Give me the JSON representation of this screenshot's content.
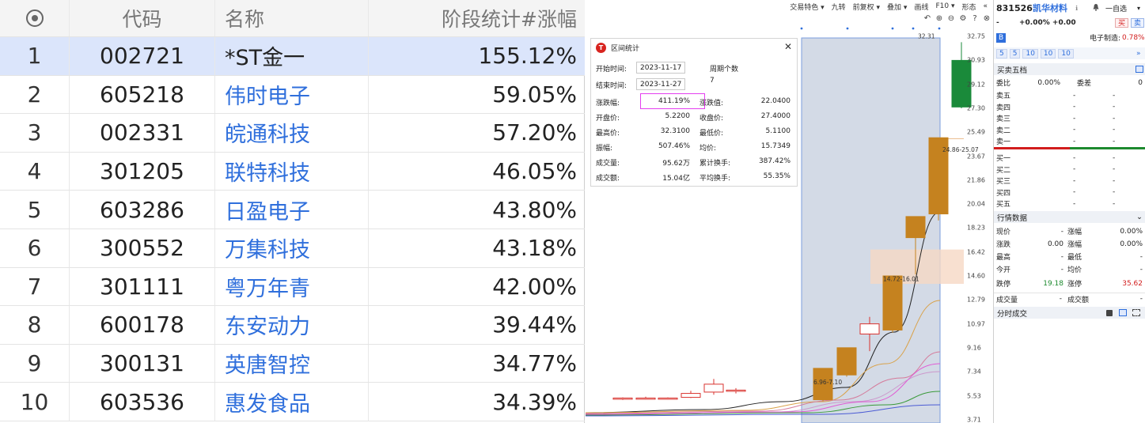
{
  "table": {
    "headers": {
      "code": "代码",
      "name": "名称",
      "pct": "阶段统计#涨幅"
    },
    "rows": [
      {
        "idx": "1",
        "code": "002721",
        "name": "*ST金一",
        "pct": "155.12%"
      },
      {
        "idx": "2",
        "code": "605218",
        "name": "伟时电子",
        "pct": "59.05%"
      },
      {
        "idx": "3",
        "code": "002331",
        "name": "皖通科技",
        "pct": "57.20%"
      },
      {
        "idx": "4",
        "code": "301205",
        "name": "联特科技",
        "pct": "46.05%"
      },
      {
        "idx": "5",
        "code": "603286",
        "name": "日盈电子",
        "pct": "43.80%"
      },
      {
        "idx": "6",
        "code": "300552",
        "name": "万集科技",
        "pct": "43.18%"
      },
      {
        "idx": "7",
        "code": "301111",
        "name": "粤万年青",
        "pct": "42.00%"
      },
      {
        "idx": "8",
        "code": "600178",
        "name": "东安动力",
        "pct": "39.44%"
      },
      {
        "idx": "9",
        "code": "300131",
        "name": "英唐智控",
        "pct": "34.77%"
      },
      {
        "idx": "10",
        "code": "603536",
        "name": "惠发食品",
        "pct": "34.39%"
      }
    ]
  },
  "chart_toolbar": [
    "交易特色 ▾",
    "九转",
    "前复权 ▾",
    "叠加 ▾",
    "画线",
    "F10 ▾",
    "形态",
    "«"
  ],
  "chart_icons": [
    "↶",
    "⊕",
    "⊖",
    "⚙",
    "?",
    "⊗"
  ],
  "stat_dialog": {
    "title": "区间统计",
    "start_label": "开始时间:",
    "start": "2023-11-17",
    "end_label": "结束时间:",
    "end": "2023-11-27",
    "period_label": "周期个数",
    "period": "7",
    "left": [
      {
        "label": "涨跌幅:",
        "value": "411.19%"
      },
      {
        "label": "开盘价:",
        "value": "5.2200"
      },
      {
        "label": "最高价:",
        "value": "32.3100"
      },
      {
        "label": "振幅:",
        "value": "507.46%"
      },
      {
        "label": "成交量:",
        "value": "95.62万"
      },
      {
        "label": "成交额:",
        "value": "15.04亿"
      }
    ],
    "right": [
      {
        "label": "涨跌值:",
        "value": "22.0400"
      },
      {
        "label": "收盘价:",
        "value": "27.4000"
      },
      {
        "label": "最低价:",
        "value": "5.1100"
      },
      {
        "label": "均价:",
        "value": "15.7349"
      },
      {
        "label": "累计换手:",
        "value": "387.42%"
      },
      {
        "label": "平均换手:",
        "value": "55.35%"
      }
    ]
  },
  "chart_data": {
    "type": "candlestick",
    "price_ticks": [
      "32.75",
      "30.93",
      "29.12",
      "27.30",
      "25.49",
      "23.67",
      "21.86",
      "20.04",
      "18.23",
      "16.42",
      "14.60",
      "12.79",
      "10.97",
      "9.16",
      "7.34",
      "5.53",
      "3.71"
    ],
    "candles": [
      {
        "open": 5.3,
        "high": 5.4,
        "low": 5.2,
        "close": 5.35
      },
      {
        "open": 5.35,
        "high": 5.45,
        "low": 5.25,
        "close": 5.3
      },
      {
        "open": 5.3,
        "high": 5.4,
        "low": 5.25,
        "close": 5.35
      },
      {
        "open": 5.4,
        "high": 5.9,
        "low": 5.35,
        "close": 5.7
      },
      {
        "open": 5.8,
        "high": 6.8,
        "low": 5.6,
        "close": 6.4
      },
      {
        "open": 5.9,
        "high": 6.1,
        "low": 5.7,
        "close": 5.95
      },
      {
        "open": 5.22,
        "high": 7.6,
        "low": 5.11,
        "close": 7.6
      },
      {
        "open": 7.1,
        "high": 9.16,
        "low": 6.96,
        "close": 9.16
      },
      {
        "open": 10.2,
        "high": 11.5,
        "low": 8.9,
        "close": 10.97
      },
      {
        "open": 10.5,
        "high": 14.6,
        "low": 10.3,
        "close": 14.6
      },
      {
        "open": 17.5,
        "high": 19.1,
        "low": 14.72,
        "close": 19.1
      },
      {
        "open": 19.3,
        "high": 25.07,
        "low": 18.8,
        "close": 25.07
      },
      {
        "open": 30.93,
        "high": 32.31,
        "low": 27.3,
        "close": 27.4
      }
    ],
    "annotations": [
      "32.31",
      "24.86-25.07",
      "14.72-16.01",
      "6.96-7.10"
    ]
  },
  "quote": {
    "code": "831526",
    "name": "凯华材料",
    "name_tag": "ℹ",
    "alert_icon": "bell-icon",
    "watch_label": "一自选",
    "price": "-",
    "change": "+0.00% +0.00",
    "buy_label": "买",
    "sell_label": "卖",
    "industry_tag": "B",
    "industry": "电子制造:",
    "industry_pct": "0.78%",
    "tabs": [
      "5",
      "5",
      "10",
      "10",
      "10"
    ],
    "five_levels_title": "买卖五档",
    "ratio_label": "委比",
    "ratio": "0.00%",
    "diff_label": "委差",
    "diff": "0",
    "sells": [
      "卖五",
      "卖四",
      "卖三",
      "卖二",
      "卖一"
    ],
    "buys": [
      "买一",
      "买二",
      "买三",
      "买四",
      "买五"
    ],
    "dash": "-",
    "market_title": "行情数据",
    "market": [
      {
        "l1": "现价",
        "v1": "-",
        "l2": "涨幅",
        "v2": "0.00%"
      },
      {
        "l1": "涨跌",
        "v1": "0.00",
        "l2": "涨幅",
        "v2": "0.00%"
      },
      {
        "l1": "最高",
        "v1": "-",
        "l2": "最低",
        "v2": "-"
      },
      {
        "l1": "今开",
        "v1": "-",
        "l2": "均价",
        "v2": "-"
      }
    ],
    "limit_down_label": "跌停",
    "limit_down": "19.18",
    "limit_up_label": "涨停",
    "limit_up": "35.62",
    "vol_label": "成交量",
    "vol": "-",
    "amt_label": "成交额",
    "amt": "-",
    "ticks_title": "分时成交"
  },
  "colors": {
    "up": "#c5821f",
    "up_hollow": "#d9332f",
    "down": "#1a8a3a",
    "selected_bg": "#c9d2e0"
  }
}
